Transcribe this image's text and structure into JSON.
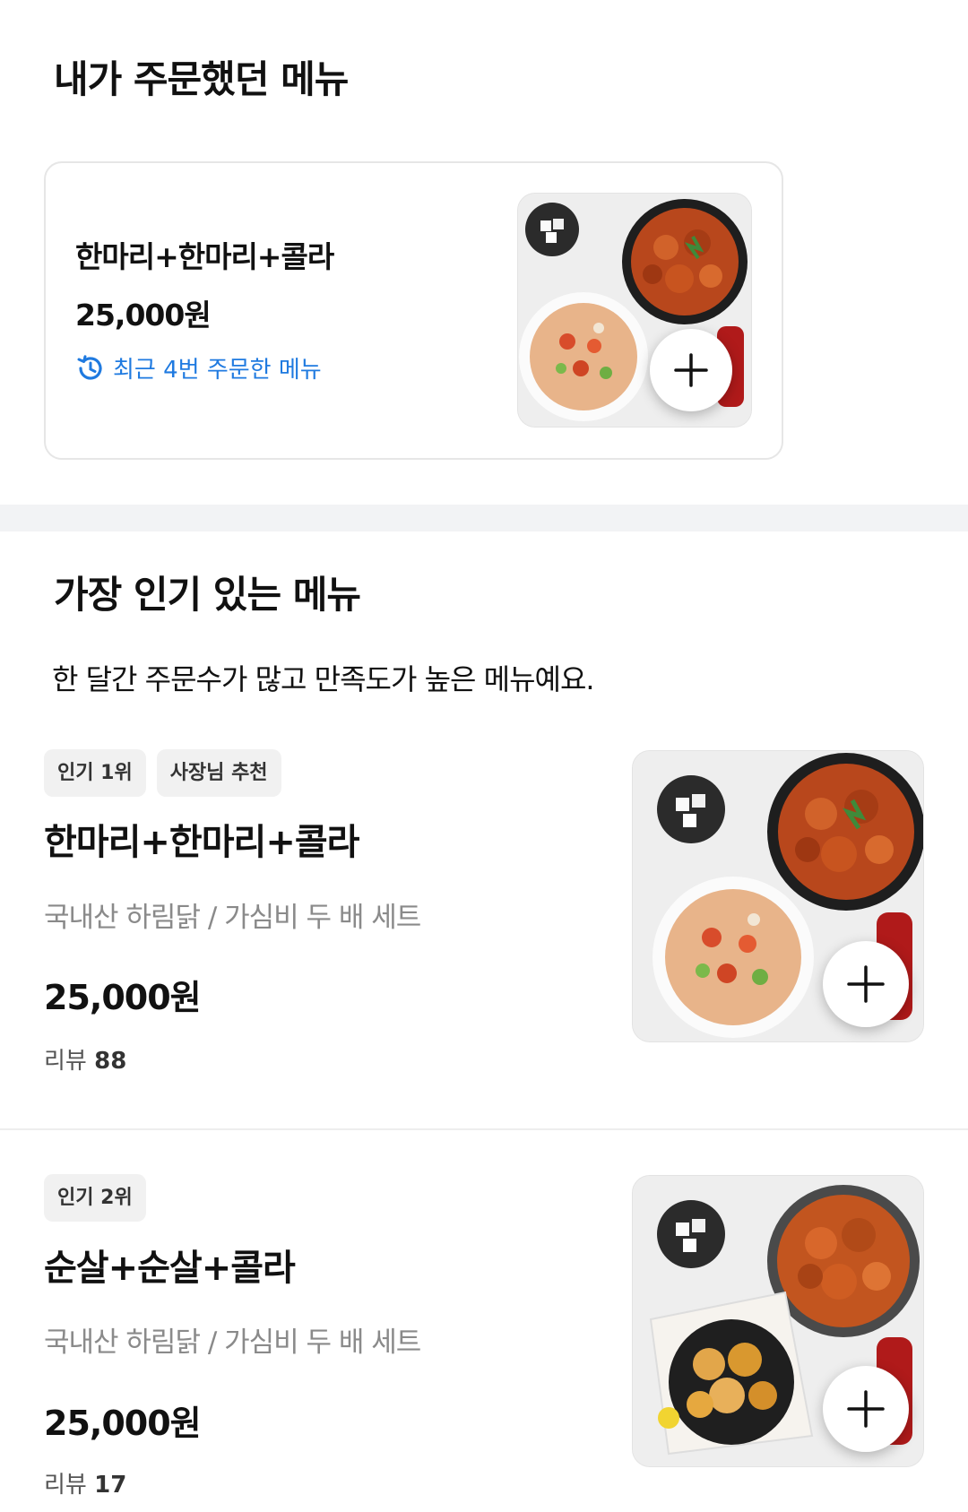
{
  "sections": {
    "ordered_title": "내가 주문했던 메뉴",
    "popular_title": "가장 인기 있는 메뉴",
    "popular_subtitle": "한 달간 주문수가 많고 만족도가 높은 메뉴예요."
  },
  "recent": {
    "name": "한마리+한마리+콜라",
    "price": "25,000원",
    "badge": "최근 4번 주문한 메뉴",
    "badge_icon": "history-clock-icon",
    "accent_color": "#1f7ae0"
  },
  "popular_items": [
    {
      "tags": [
        "인기 1위",
        "사장님 추천"
      ],
      "name": "한마리+한마리+콜라",
      "desc": "국내산 하림닭 / 가심비 두 배 세트",
      "price": "25,000원",
      "review_label": "리뷰",
      "review_count": "88"
    },
    {
      "tags": [
        "인기 2위"
      ],
      "name": "순살+순살+콜라",
      "desc": "국내산 하림닭 / 가심비 두 배 세트",
      "price": "25,000원",
      "review_label": "리뷰",
      "review_count": "17"
    }
  ],
  "icons": {
    "add": "plus-icon",
    "food": "chicken-set-image"
  }
}
